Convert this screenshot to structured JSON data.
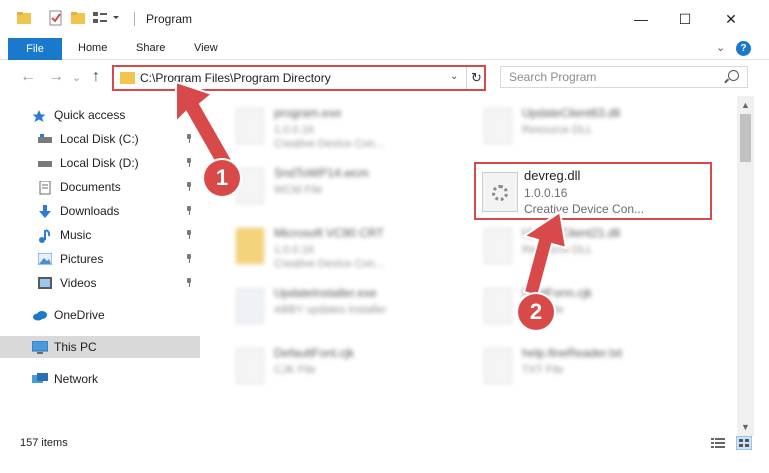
{
  "window": {
    "title": "Program",
    "minimize_glyph": "—",
    "maximize_glyph": "☐",
    "close_glyph": "✕"
  },
  "ribbon": {
    "tabs": [
      "File",
      "Home",
      "Share",
      "View"
    ],
    "help_glyph": "?",
    "collapse_glyph": "⌄"
  },
  "nav": {
    "back_glyph": "←",
    "forward_glyph": "→",
    "history_glyph": "⌄",
    "up_glyph": "↑"
  },
  "address": {
    "path": "C:\\Program Files\\Program Directory",
    "dropdown_glyph": "⌄",
    "refresh_glyph": "↻"
  },
  "search": {
    "placeholder": "Search Program"
  },
  "sidebar": {
    "items": [
      {
        "label": "Quick access",
        "icon": "star-icon",
        "pinned": false
      },
      {
        "label": "Local Disk (C:)",
        "icon": "drive-icon",
        "pinned": true
      },
      {
        "label": "Local Disk (D:)",
        "icon": "drive-icon",
        "pinned": true
      },
      {
        "label": "Documents",
        "icon": "documents-icon",
        "pinned": true
      },
      {
        "label": "Downloads",
        "icon": "download-icon",
        "pinned": true
      },
      {
        "label": "Music",
        "icon": "music-icon",
        "pinned": true
      },
      {
        "label": "Pictures",
        "icon": "pictures-icon",
        "pinned": true
      },
      {
        "label": "Videos",
        "icon": "videos-icon",
        "pinned": true
      },
      {
        "label": "OneDrive",
        "icon": "cloud-icon",
        "pinned": false
      },
      {
        "label": "This PC",
        "icon": "computer-icon",
        "pinned": false,
        "selected": true
      },
      {
        "label": "Network",
        "icon": "network-icon",
        "pinned": false
      }
    ]
  },
  "files": {
    "left": [
      {
        "name": "program.exe",
        "version": "1.0.0.16",
        "desc": "Creative Device Con..."
      },
      {
        "name": "SndToWP14.wcm",
        "version": "WCM File",
        "desc": ""
      },
      {
        "name": "Microsoft VC90 CRT",
        "version": "1.0.0.16",
        "desc": "Creative Device Con..."
      },
      {
        "name": "UpdateInstaller.exe",
        "version": "ABBY updates installer",
        "desc": ""
      },
      {
        "name": "DefaultFont.cjk",
        "version": "CJK File",
        "desc": ""
      }
    ],
    "right": [
      {
        "name": "UpdateClient63.dll",
        "version": "Resource DLL",
        "desc": ""
      },
      {
        "name": "UpdateClient21.dll",
        "version": "Resource DLL",
        "desc": ""
      },
      {
        "name": "FontForm.cjk",
        "version": "CJK File",
        "desc": ""
      },
      {
        "name": "help.fineReader.txt",
        "version": "TXT File",
        "desc": ""
      }
    ],
    "highlighted": {
      "name": "devreg.dll",
      "version": "1.0.0.16",
      "desc": "Creative Device Con..."
    }
  },
  "status": {
    "item_count": "157 items"
  },
  "callouts": [
    {
      "number": "1"
    },
    {
      "number": "2"
    }
  ],
  "colors": {
    "accent": "#1979ca",
    "highlight": "#d84a4a",
    "folder": "#f1c44e"
  }
}
